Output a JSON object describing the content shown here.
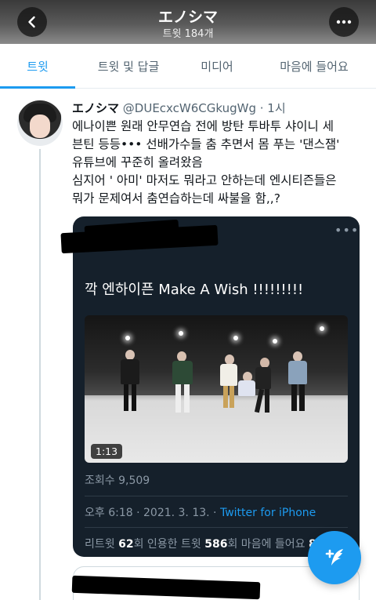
{
  "header": {
    "title": "エノシマ",
    "subtitle": "트윗 184개",
    "back_icon": "arrow-left-icon",
    "more_icon": "ellipsis-icon"
  },
  "tabs": [
    {
      "label": "트윗",
      "active": true
    },
    {
      "label": "트윗 및 답글",
      "active": false
    },
    {
      "label": "미디어",
      "active": false
    },
    {
      "label": "마음에 들어요",
      "active": false
    }
  ],
  "tweet": {
    "display_name": "エノシマ",
    "handle_time": "@DUEcxcW6CGkugWg · 1시",
    "lines": [
      "에나이쁜 원래 안무연습 전에 방탄 투바투 샤이니 세",
      "븐틴 등등••• 선배가수들 춤 추면서 몸 푸는 '댄스잼'",
      "유튜브에 꾸준히 올려왔음",
      "심지어 ' 아미' 마저도 뭐라고 안하는데 엔시티즌들은",
      "뭐가 문제여서 춤연습하는데 싸불을 함,,?"
    ]
  },
  "quoted": {
    "more": "•••",
    "text": "깍 엔하이픈 Make A Wish !!!!!!!!!",
    "video_duration": "1:13",
    "views": "조회수 9,509",
    "time": "오후 6:18 · 2021. 3. 13. · ",
    "source": "Twitter for iPhone",
    "stats": {
      "retweets_label": "리트윗 ",
      "retweets_value": "62",
      "retweets_unit": "회",
      "quotes_label": "  인용한 트윗 ",
      "quotes_value": "586",
      "quotes_unit": "회",
      "likes_label": "  마음에 들어요 ",
      "likes_value": "8"
    }
  },
  "fab": {
    "icon": "compose-tweet-icon"
  },
  "colors": {
    "accent": "#1d9bf0",
    "card_bg": "#15202b"
  }
}
